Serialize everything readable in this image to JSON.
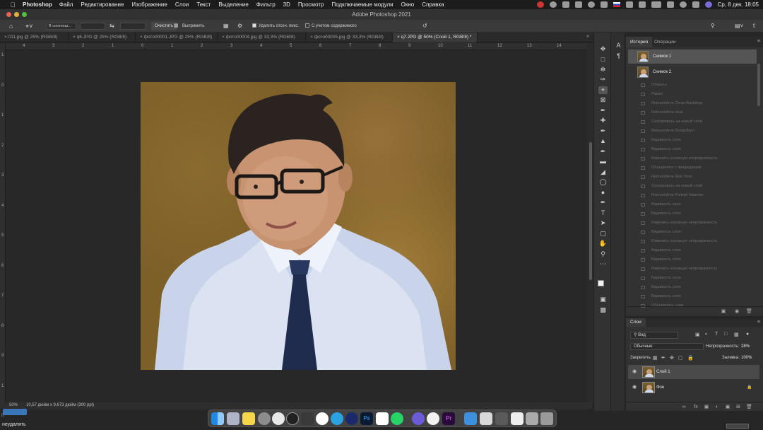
{
  "menubar": {
    "app_name": "Photoshop",
    "items": [
      "Файл",
      "Редактирование",
      "Изображение",
      "Слои",
      "Текст",
      "Выделение",
      "Фильтр",
      "3D",
      "Просмотр",
      "Подключаемые модули",
      "Окно",
      "Справка"
    ],
    "clock": "Ср, 8 дек.  18:05"
  },
  "window": {
    "title": "Adobe Photoshop 2021"
  },
  "options": {
    "ratio_label": "В соотнош...",
    "clear_button": "Очистить",
    "straighten_label": "Выпрямить",
    "delete_cropped_label": "Удалить отсеч. пикс.",
    "content_aware_label": "С учетом содержимого"
  },
  "tabs": [
    {
      "label": "011.jpg @ 25% (RGB/8)"
    },
    {
      "label": "q6.JPG @ 25% (RGB/8)"
    },
    {
      "label": "фото00001.JPG @ 25% (RGB/8)"
    },
    {
      "label": "фото00004.jpg @ 33,3% (RGB/8)"
    },
    {
      "label": "фото00005.jpg @ 33,3% (RGB/8)"
    },
    {
      "label": "q7.JPG @ 50% (Слой 1, RGB/8) *"
    }
  ],
  "ruler_h": [
    "4",
    "3",
    "2",
    "1",
    "0",
    "1",
    "2",
    "3",
    "4",
    "5",
    "6",
    "7",
    "8",
    "9",
    "10",
    "11",
    "12",
    "13",
    "14"
  ],
  "ruler_v": [
    "1",
    "0",
    "1",
    "2",
    "3",
    "4",
    "5",
    "6",
    "7",
    "8",
    "9",
    "1",
    "0"
  ],
  "status": {
    "zoom": "50%",
    "doc_info": "10,57 дюйм x 9,673 дюйм (300 ppi)"
  },
  "history_panel": {
    "tabs": [
      "История",
      "Операции"
    ],
    "snapshots": [
      "Снимок 1",
      "Снимок 2"
    ],
    "steps": [
      "Открыть",
      "Рамка",
      "RetouchAme Clean Backdrop",
      "RetouchAme Heal",
      "Скопировать на новый слой",
      "RetouchAme DodgeBurn",
      "Видимость слоя",
      "Видимость слоя",
      "Изменить основную непрозрачность",
      "Объединить с предыдущим",
      "RetouchAme Skin Tone",
      "Скопировать на новый слой",
      "RetouchAme Portrait Volumes",
      "Видимость слоя",
      "Видимость слоя",
      "Изменить основную непрозрачность",
      "Видимость слоя",
      "Изменить основную непрозрачность",
      "Видимость слоя",
      "Видимость слоя",
      "Изменить основную непрозрачность",
      "Видимость слоя",
      "Видимость слоя",
      "Видимость слоя",
      "Объединить слои"
    ]
  },
  "layers_panel": {
    "title": "Слои",
    "filter": "Вид",
    "blend_mode": "Обычные",
    "opacity_label": "Непрозрачность:",
    "opacity_value": "28%",
    "lock_label": "Закрепить:",
    "fill_label": "Заливка:",
    "fill_value": "100%",
    "layers": [
      {
        "name": "Слой 1"
      },
      {
        "name": "Фон"
      }
    ]
  },
  "bottom_status": "неудалять"
}
